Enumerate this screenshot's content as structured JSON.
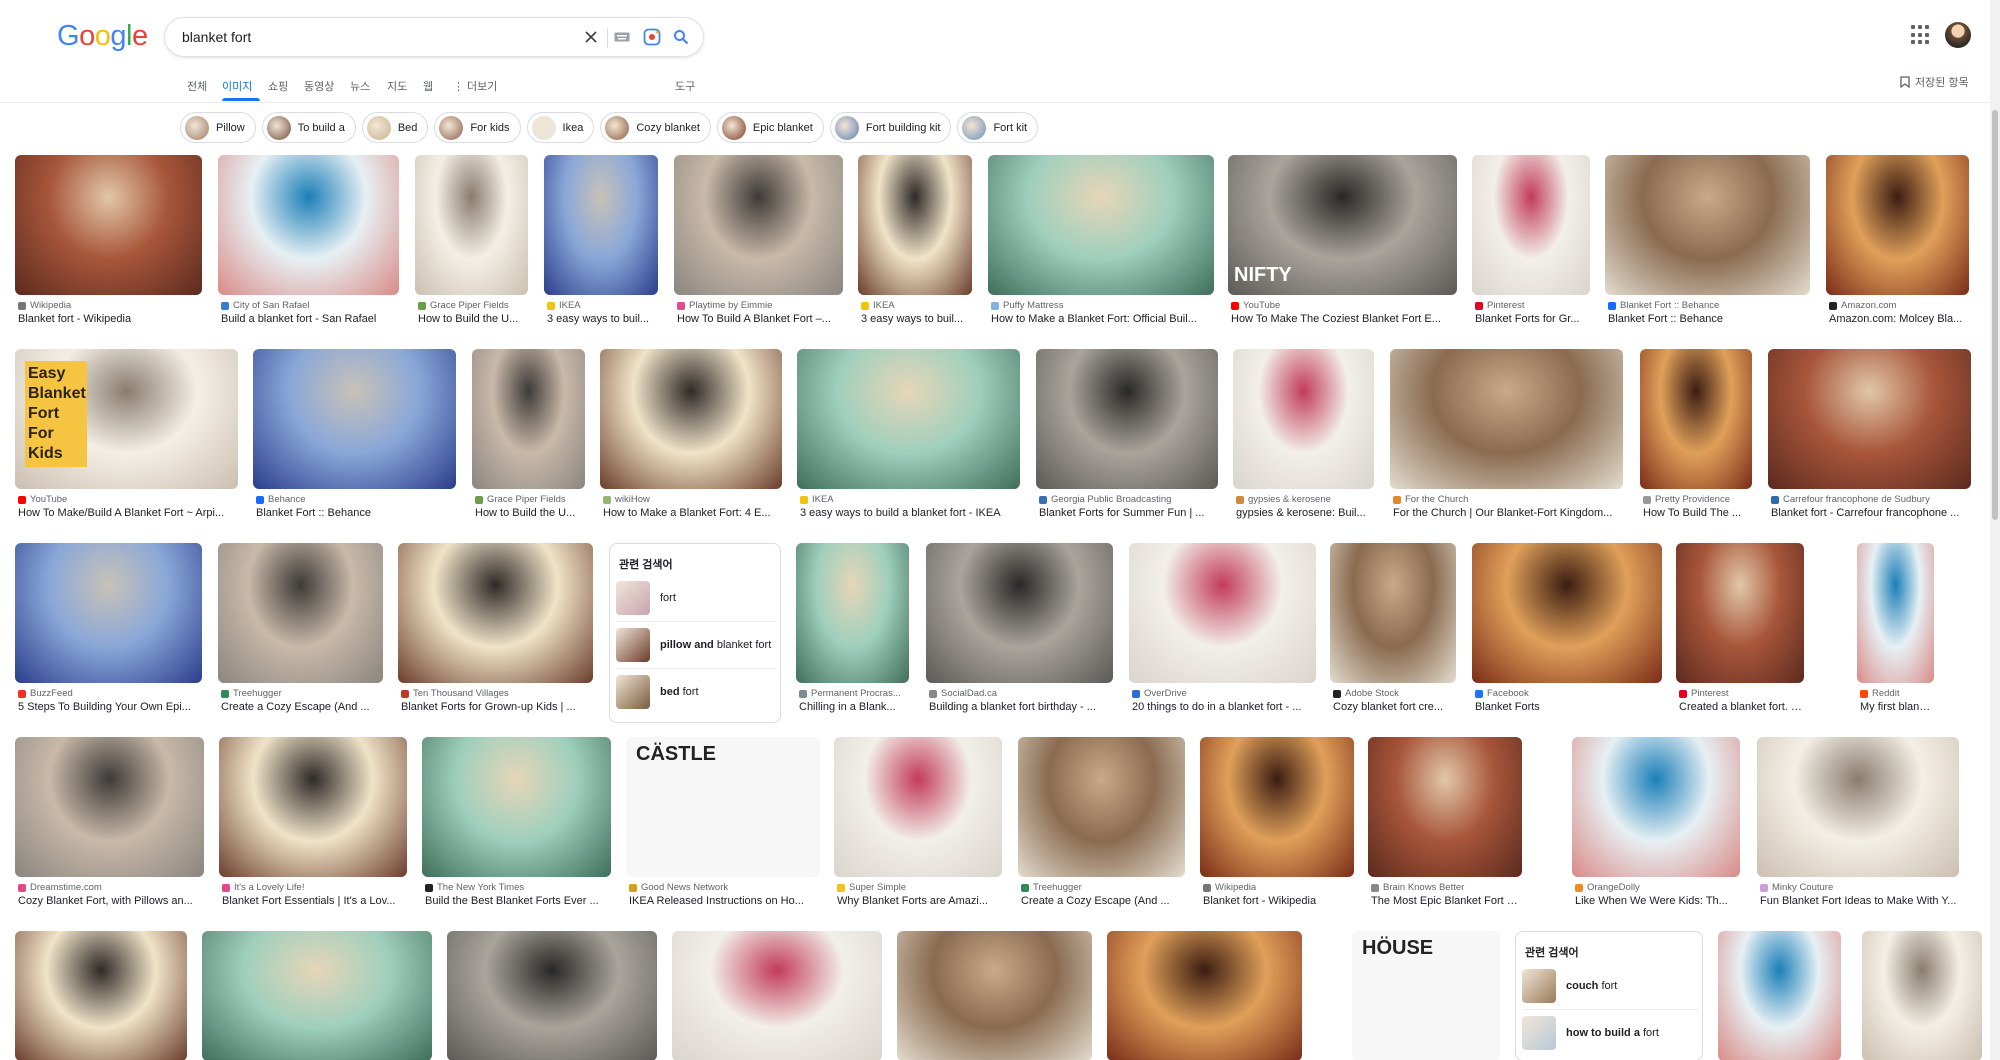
{
  "logo": {
    "text": "Google"
  },
  "search": {
    "query": "blanket fort"
  },
  "tabs": [
    "전체",
    "이미지",
    "쇼핑",
    "동영상",
    "뉴스",
    "지도",
    "웹",
    "⋮ 더보기"
  ],
  "tools_label": "도구",
  "saved_label": "저장된 항목",
  "chips": [
    {
      "label": "Pillow",
      "color": "#9b7d6a"
    },
    {
      "label": "To build a",
      "color": "#6d4c3d"
    },
    {
      "label": "Bed",
      "color": "#c9b28f"
    },
    {
      "label": "For kids",
      "color": "#8c5e4e"
    },
    {
      "label": "Ikea",
      "color": "#e7e4df"
    },
    {
      "label": "Cozy blanket",
      "color": "#8a5a3e"
    },
    {
      "label": "Epic blanket",
      "color": "#7a3b25"
    },
    {
      "label": "Fort building kit",
      "color": "#5e7fb6"
    },
    {
      "label": "Fort kit",
      "color": "#6b8eb8"
    }
  ],
  "results": [
    {
      "source": "Wikipedia",
      "title": "Blanket fort - Wikipedia",
      "fav": "#777"
    },
    {
      "source": "City of San Rafael",
      "title": "Build a blanket fort - San Rafael",
      "fav": "#3a7bd5"
    },
    {
      "source": "Grace Piper Fields",
      "title": "How to Build the U...",
      "fav": "#6b9e4b"
    },
    {
      "source": "IKEA",
      "title": "3 easy ways to buil...",
      "fav": "#f1c40f"
    },
    {
      "source": "Playtime by Eimmie",
      "title": "How To Build A Blanket Fort –...",
      "fav": "#e24a8b"
    },
    {
      "source": "IKEA",
      "title": "3 easy ways to buil...",
      "fav": "#f1c40f"
    },
    {
      "source": "Puffy Mattress",
      "title": "How to Make a Blanket Fort: Official Buil...",
      "fav": "#7fb3e0"
    },
    {
      "source": "YouTube",
      "title": "How To Make The Coziest Blanket Fort E...",
      "fav": "#ff0000",
      "overlay": "NIFTY"
    },
    {
      "source": "Pinterest",
      "title": "Blanket Forts for Gr...",
      "fav": "#e60023"
    },
    {
      "source": "Blanket Fort :: Behance",
      "title": "Blanket Fort :: Behance",
      "fav": "#1769ff"
    },
    {
      "source": "Amazon.com",
      "title": "Amazon.com: Molcey Bla...",
      "fav": "#222"
    },
    {
      "source": "YouTube",
      "title": "How To Make/Build A Blanket Fort ~ Arpi...",
      "fav": "#ff0000",
      "overlay": "Easy Blanket Fort For Kids"
    },
    {
      "source": "Behance",
      "title": "Blanket Fort :: Behance",
      "fav": "#1769ff"
    },
    {
      "source": "Grace Piper Fields",
      "title": "How to Build the U...",
      "fav": "#6b9e4b"
    },
    {
      "source": "wikiHow",
      "title": "How to Make a Blanket Fort: 4 E...",
      "fav": "#93b874"
    },
    {
      "source": "IKEA",
      "title": "3 easy ways to build a blanket fort - IKEA",
      "fav": "#f1c40f"
    },
    {
      "source": "Georgia Public Broadcasting",
      "title": "Blanket Forts for Summer Fun | ...",
      "fav": "#3a6fb5"
    },
    {
      "source": "gypsies & kerosene",
      "title": "gypsies & kerosene: Buil...",
      "fav": "#d08a3c"
    },
    {
      "source": "For the Church",
      "title": "For the Church | Our Blanket-Fort Kingdom...",
      "fav": "#e08a2c"
    },
    {
      "source": "Pretty Providence",
      "title": "How To Build The ...",
      "fav": "#999"
    },
    {
      "source": "Carrefour francophone de Sudbury",
      "title": "Blanket fort - Carrefour francophone ...",
      "fav": "#2b6cb0"
    },
    {
      "source": "BuzzFeed",
      "title": "5 Steps To Building Your Own Epi...",
      "fav": "#ee3322"
    },
    {
      "source": "Treehugger",
      "title": "Create a Cozy Escape (And ...",
      "fav": "#2e8b57"
    },
    {
      "source": "Ten Thousand Villages",
      "title": "Blanket Forts for Grown-up Kids | ...",
      "fav": "#c0392b"
    },
    {
      "source": "Permanent Procras...",
      "title": "Chilling in a Blank...",
      "fav": "#7a8b99"
    },
    {
      "source": "SocialDad.ca",
      "title": "Building a blanket fort birthday - ...",
      "fav": "#888"
    },
    {
      "source": "OverDrive",
      "title": "20 things to do in a blanket fort - ...",
      "fav": "#2a6dd8"
    },
    {
      "source": "Adobe Stock",
      "title": "Cozy blanket fort cre...",
      "fav": "#222"
    },
    {
      "source": "Facebook",
      "title": "Blanket Forts",
      "fav": "#1877f2"
    },
    {
      "source": "Pinterest",
      "title": "Created a blanket fort. Feels ...",
      "fav": "#e60023"
    },
    {
      "source": "Reddit",
      "title": "My first blanket fort...",
      "fav": "#ff4500"
    },
    {
      "source": "Dreamstime.com",
      "title": "Cozy Blanket Fort, with Pillows an...",
      "fav": "#e24a8b"
    },
    {
      "source": "It's a Lovely Life!",
      "title": "Blanket Fort Essentials | It's a Lov...",
      "fav": "#e24a8b"
    },
    {
      "source": "The New York Times",
      "title": "Build the Best Blanket Forts Ever ...",
      "fav": "#222"
    },
    {
      "source": "Good News Network",
      "title": "IKEA Released Instructions on Ho...",
      "fav": "#d4a017",
      "overlay": "CÄSTLE"
    },
    {
      "source": "Super Simple",
      "title": "Why Blanket Forts are Amazi...",
      "fav": "#f0c419"
    },
    {
      "source": "Treehugger",
      "title": "Create a Cozy Escape (And ...",
      "fav": "#2e8b57"
    },
    {
      "source": "Wikipedia",
      "title": "Blanket fort - Wikipedia",
      "fav": "#777"
    },
    {
      "source": "Brain Knows Better",
      "title": "The Most Epic Blanket Fort and t...",
      "fav": "#888"
    },
    {
      "source": "OrangeDolly",
      "title": "Like When We Were Kids: Th...",
      "fav": "#f08a24"
    },
    {
      "source": "Minky Couture",
      "title": "Fun Blanket Fort Ideas to Make With Y...",
      "fav": "#c9a0dc"
    },
    {
      "source": "",
      "title": "",
      "fav": "#fff"
    },
    {
      "source": "",
      "title": "",
      "fav": "#fff"
    },
    {
      "source": "",
      "title": "",
      "fav": "#fff"
    },
    {
      "source": "",
      "title": "",
      "fav": "#fff"
    },
    {
      "source": "",
      "title": "",
      "fav": "#fff"
    },
    {
      "source": "",
      "title": "",
      "fav": "#fff"
    },
    {
      "source": "",
      "title": "",
      "fav": "#fff",
      "overlay": "HÖUSE"
    },
    {
      "source": "",
      "title": "",
      "fav": "#fff"
    },
    {
      "source": "",
      "title": "",
      "fav": "#fff"
    }
  ],
  "related1": {
    "heading": "관련 검색어",
    "items": [
      {
        "bold": "",
        "rest": "fort",
        "color": "#c9a3b0"
      },
      {
        "bold": "pillow and",
        "rest": " blanket fort",
        "color": "#6b3a2a"
      },
      {
        "bold": "bed",
        "rest": " fort",
        "color": "#7a5a3a"
      }
    ]
  },
  "related2": {
    "heading": "관련 검색어",
    "items": [
      {
        "bold": "couch",
        "rest": " fort",
        "color": "#9a7a5a"
      },
      {
        "bold": "how to build a",
        "rest": " fort",
        "color": "#b8c8d8"
      }
    ]
  },
  "colors": {
    "accent": "#1a73e8",
    "text": "#202124",
    "muted": "#5f6368"
  }
}
